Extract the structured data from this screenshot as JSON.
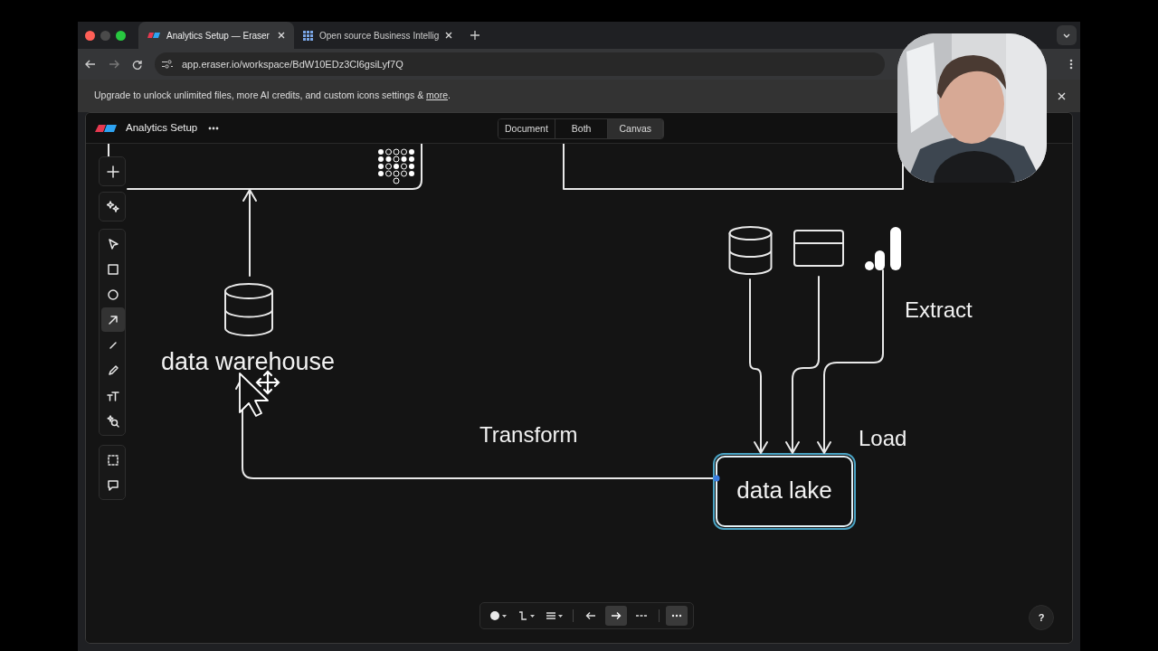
{
  "browser": {
    "tabs": [
      {
        "title": "Analytics Setup — Eraser",
        "selected": true
      },
      {
        "title": "Open source Business Intellig",
        "selected": false
      }
    ],
    "url": "app.eraser.io/workspace/BdW10EDz3Cl6gsiLyf7Q"
  },
  "banner": {
    "text": "Upgrade to unlock unlimited files, more AI credits, and custom icons settings & ",
    "link": "more",
    "suffix": "."
  },
  "app": {
    "title": "Analytics Setup",
    "views": [
      {
        "label": "Document",
        "selected": false
      },
      {
        "label": "Both",
        "selected": false
      },
      {
        "label": "Canvas",
        "selected": true
      }
    ]
  },
  "toolbar": {
    "groups": [
      {
        "tools": [
          {
            "kind": "add",
            "selected": false
          }
        ]
      },
      {
        "tools": [
          {
            "kind": "ai",
            "selected": false
          }
        ]
      },
      {
        "tools": [
          {
            "kind": "select",
            "selected": false
          },
          {
            "kind": "rect",
            "selected": false
          },
          {
            "kind": "ellipse",
            "selected": false
          },
          {
            "kind": "arrow",
            "selected": true
          },
          {
            "kind": "line",
            "selected": false
          },
          {
            "kind": "pencil",
            "selected": false
          },
          {
            "kind": "text",
            "selected": false
          },
          {
            "kind": "icons",
            "selected": false
          }
        ]
      },
      {
        "tools": [
          {
            "kind": "frame",
            "selected": false
          },
          {
            "kind": "comment",
            "selected": false
          }
        ]
      }
    ]
  },
  "diagram": {
    "nodes": [
      {
        "label": "data warehouse",
        "selected": false
      },
      {
        "label": "data lake",
        "selected": true
      }
    ],
    "edge_labels": [
      "Transform",
      "Extract",
      "Load"
    ]
  },
  "style_bar": {
    "items": [
      {
        "kind": "fill",
        "selected": false
      },
      {
        "kind": "curve",
        "selected": false
      },
      {
        "kind": "weight",
        "selected": false
      },
      {
        "kind": "start-arrow",
        "selected": false
      },
      {
        "kind": "end-arrow",
        "selected": true
      },
      {
        "kind": "dash",
        "selected": false
      },
      {
        "kind": "more",
        "selected": true
      }
    ]
  },
  "help": {
    "label": "?"
  }
}
